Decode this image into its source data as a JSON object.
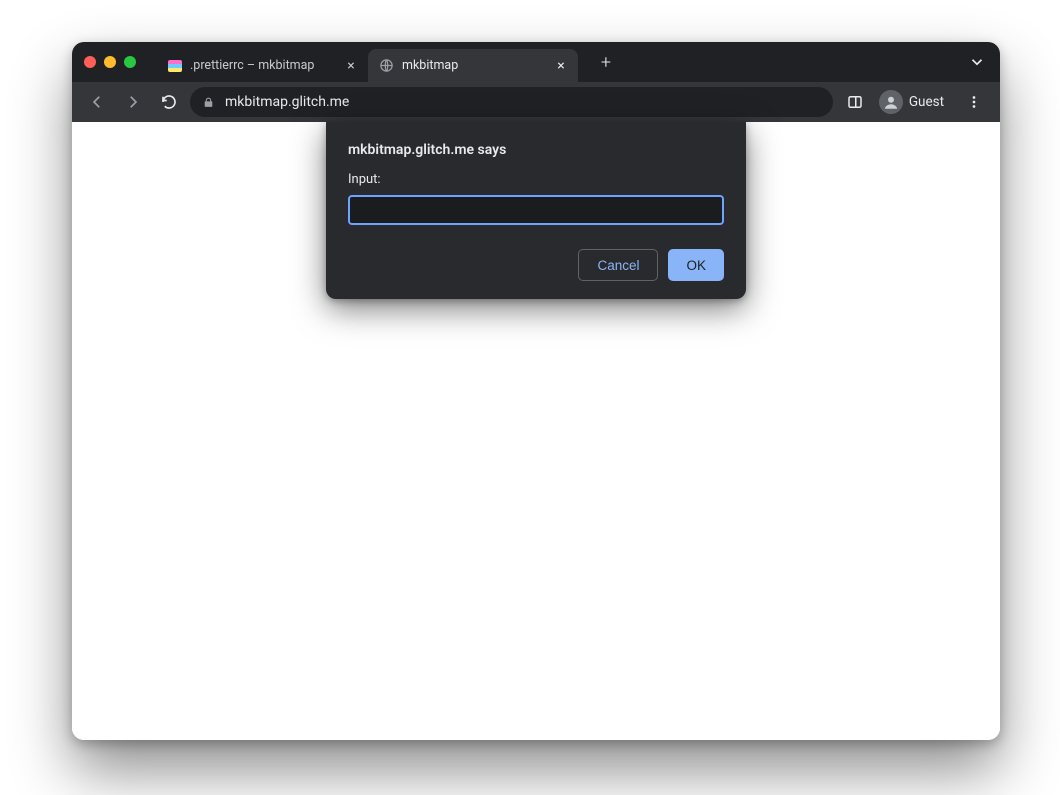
{
  "tabs": [
    {
      "title": ".prettierrc – mkbitmap",
      "favicon": "glitch",
      "active": false
    },
    {
      "title": "mkbitmap",
      "favicon": "globe",
      "active": true
    }
  ],
  "toolbar": {
    "url": "mkbitmap.glitch.me",
    "profile_label": "Guest"
  },
  "prompt": {
    "origin_text": "mkbitmap.glitch.me says",
    "label": "Input:",
    "value": "",
    "cancel_label": "Cancel",
    "ok_label": "OK"
  }
}
